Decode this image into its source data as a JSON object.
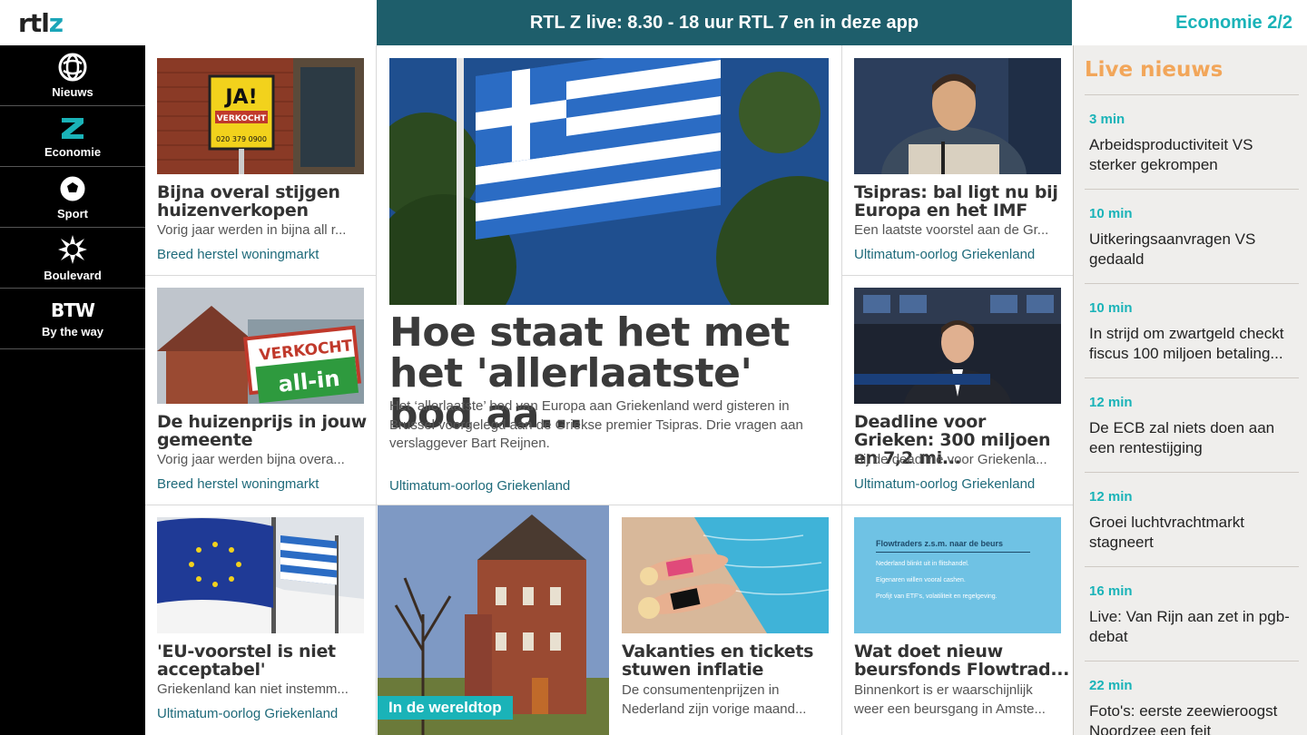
{
  "header": {
    "logo": "rtlz",
    "live_banner": "RTL Z live: 8.30 - 18 uur RTL 7 en in deze app",
    "section_page": "Economie 2/2"
  },
  "sidebar": {
    "items": [
      {
        "label": "Nieuws",
        "icon": "globe-icon"
      },
      {
        "label": "Economie",
        "icon": "z-logo-icon"
      },
      {
        "label": "Sport",
        "icon": "football-icon"
      },
      {
        "label": "Boulevard",
        "icon": "sunburst-icon"
      },
      {
        "label": "By the way",
        "icon": "btw-logo",
        "icon_text": "BTW"
      }
    ]
  },
  "cards": {
    "c1": {
      "title": "Bijna overal stijgen huizenverkopen",
      "desc": "Vorig jaar werden in bijna all r...",
      "tag": "Breed herstel woningmarkt",
      "sign_text": "JA!",
      "sign_sub": "VERKOCHT",
      "sign_phone": "020 379 0900"
    },
    "c2": {
      "title": "De huizenprijs in jouw gemeente",
      "desc": "Vorig jaar werden bijna overa...",
      "tag": "Breed herstel woningmarkt",
      "sign_text": "VERKOCHT",
      "sign_sub": "all-in"
    },
    "hero": {
      "title": "Hoe staat het met het 'allerlaatste' bod aa...",
      "desc": "Het ‘allerlaatste’ bod van Europa aan Griekenland werd gisteren in Brussel voorgelegd aan de Griekse premier Tsipras. Drie vragen aan verslaggever Bart Reijnen.",
      "tag": "Ultimatum-oorlog Griekenland"
    },
    "c3": {
      "title": "Tsipras: bal ligt nu bij Europa en het IMF",
      "desc": "Een laatste voorstel aan de Gr...",
      "tag": "Ultimatum-oorlog Griekenland"
    },
    "c4": {
      "title": "Deadline voor Grieken: 300 miljoen en 7,2 mi...",
      "desc": "Bij de deadline voor Griekenla...",
      "tag": "Ultimatum-oorlog Griekenland"
    },
    "c5": {
      "title": "'EU-voorstel is niet acceptabel'",
      "desc": "Griekenland kan niet instemm...",
      "tag": "Ultimatum-oorlog Griekenland"
    },
    "c6": {
      "badge": "In de wereldtop"
    },
    "c7": {
      "title": "Vakanties en tickets stuwen inflatie",
      "desc": "De consumentenprijzen in Nederland zijn vorige maand..."
    },
    "c8": {
      "title": "Wat doet nieuw beursfonds Flowtrad...",
      "desc": "Binnenkort is er waarschijnlijk weer een beursgang in Amste...",
      "slide_title": "Flowtraders z.s.m. naar de beurs",
      "slide_lines": [
        "Nederland blinkt uit in flitshandel.",
        "Eigenaren willen vooral cashen.",
        "Profijt van ETF's, volatiliteit en regelgeving."
      ]
    }
  },
  "live": {
    "title": "Live nieuws",
    "items": [
      {
        "time": "3 min",
        "text": "Arbeidsproductiviteit VS sterker gekrompen"
      },
      {
        "time": "10 min",
        "text": "Uitkeringsaanvragen VS gedaald"
      },
      {
        "time": "10 min",
        "text": "In strijd om zwartgeld checkt fiscus 100 miljoen betaling..."
      },
      {
        "time": "12 min",
        "text": "De ECB zal niets doen aan een rentestijging"
      },
      {
        "time": "12 min",
        "text": "Groei luchtvrachtmarkt stagneert"
      },
      {
        "time": "16 min",
        "text": "Live: Van Rijn aan zet in pgb-debat"
      },
      {
        "time": "22 min",
        "text": "Foto's: eerste zeewieroogst Noordzee een feit"
      }
    ]
  },
  "colors": {
    "header_live_bg": "#1e5e6b",
    "accent": "#1ab3b8",
    "live_title": "#f2a65a",
    "tag": "#1e6a7a",
    "sidebar_bg": "#000000"
  }
}
